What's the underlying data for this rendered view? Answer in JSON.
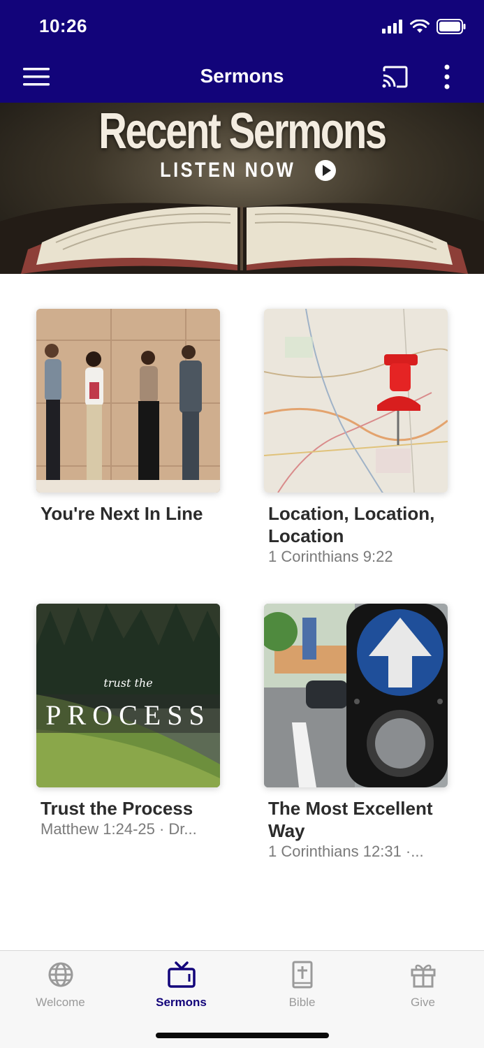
{
  "status": {
    "time": "10:26"
  },
  "nav": {
    "title": "Sermons"
  },
  "banner": {
    "title": "Recent Sermons",
    "cta": "LISTEN NOW"
  },
  "sermons": [
    {
      "title": "You're Next In Line",
      "subtitle": ""
    },
    {
      "title": "Location, Location, Location",
      "subtitle": "1 Corinthians 9:22"
    },
    {
      "title": "Trust the Process",
      "subtitle": "Matthew 1:24-25 · Dr...",
      "thumb_text_small": "trust the",
      "thumb_text_large": "PROCESS"
    },
    {
      "title": "The Most Excellent Way",
      "subtitle": "1 Corinthians 12:31 ·..."
    }
  ],
  "tabs": [
    {
      "label": "Welcome",
      "icon": "globe-icon"
    },
    {
      "label": "Sermons",
      "icon": "tv-icon"
    },
    {
      "label": "Bible",
      "icon": "bible-icon"
    },
    {
      "label": "Give",
      "icon": "gift-icon"
    }
  ],
  "colors": {
    "brand": "#12047a",
    "inactive": "#9a9a9a"
  }
}
